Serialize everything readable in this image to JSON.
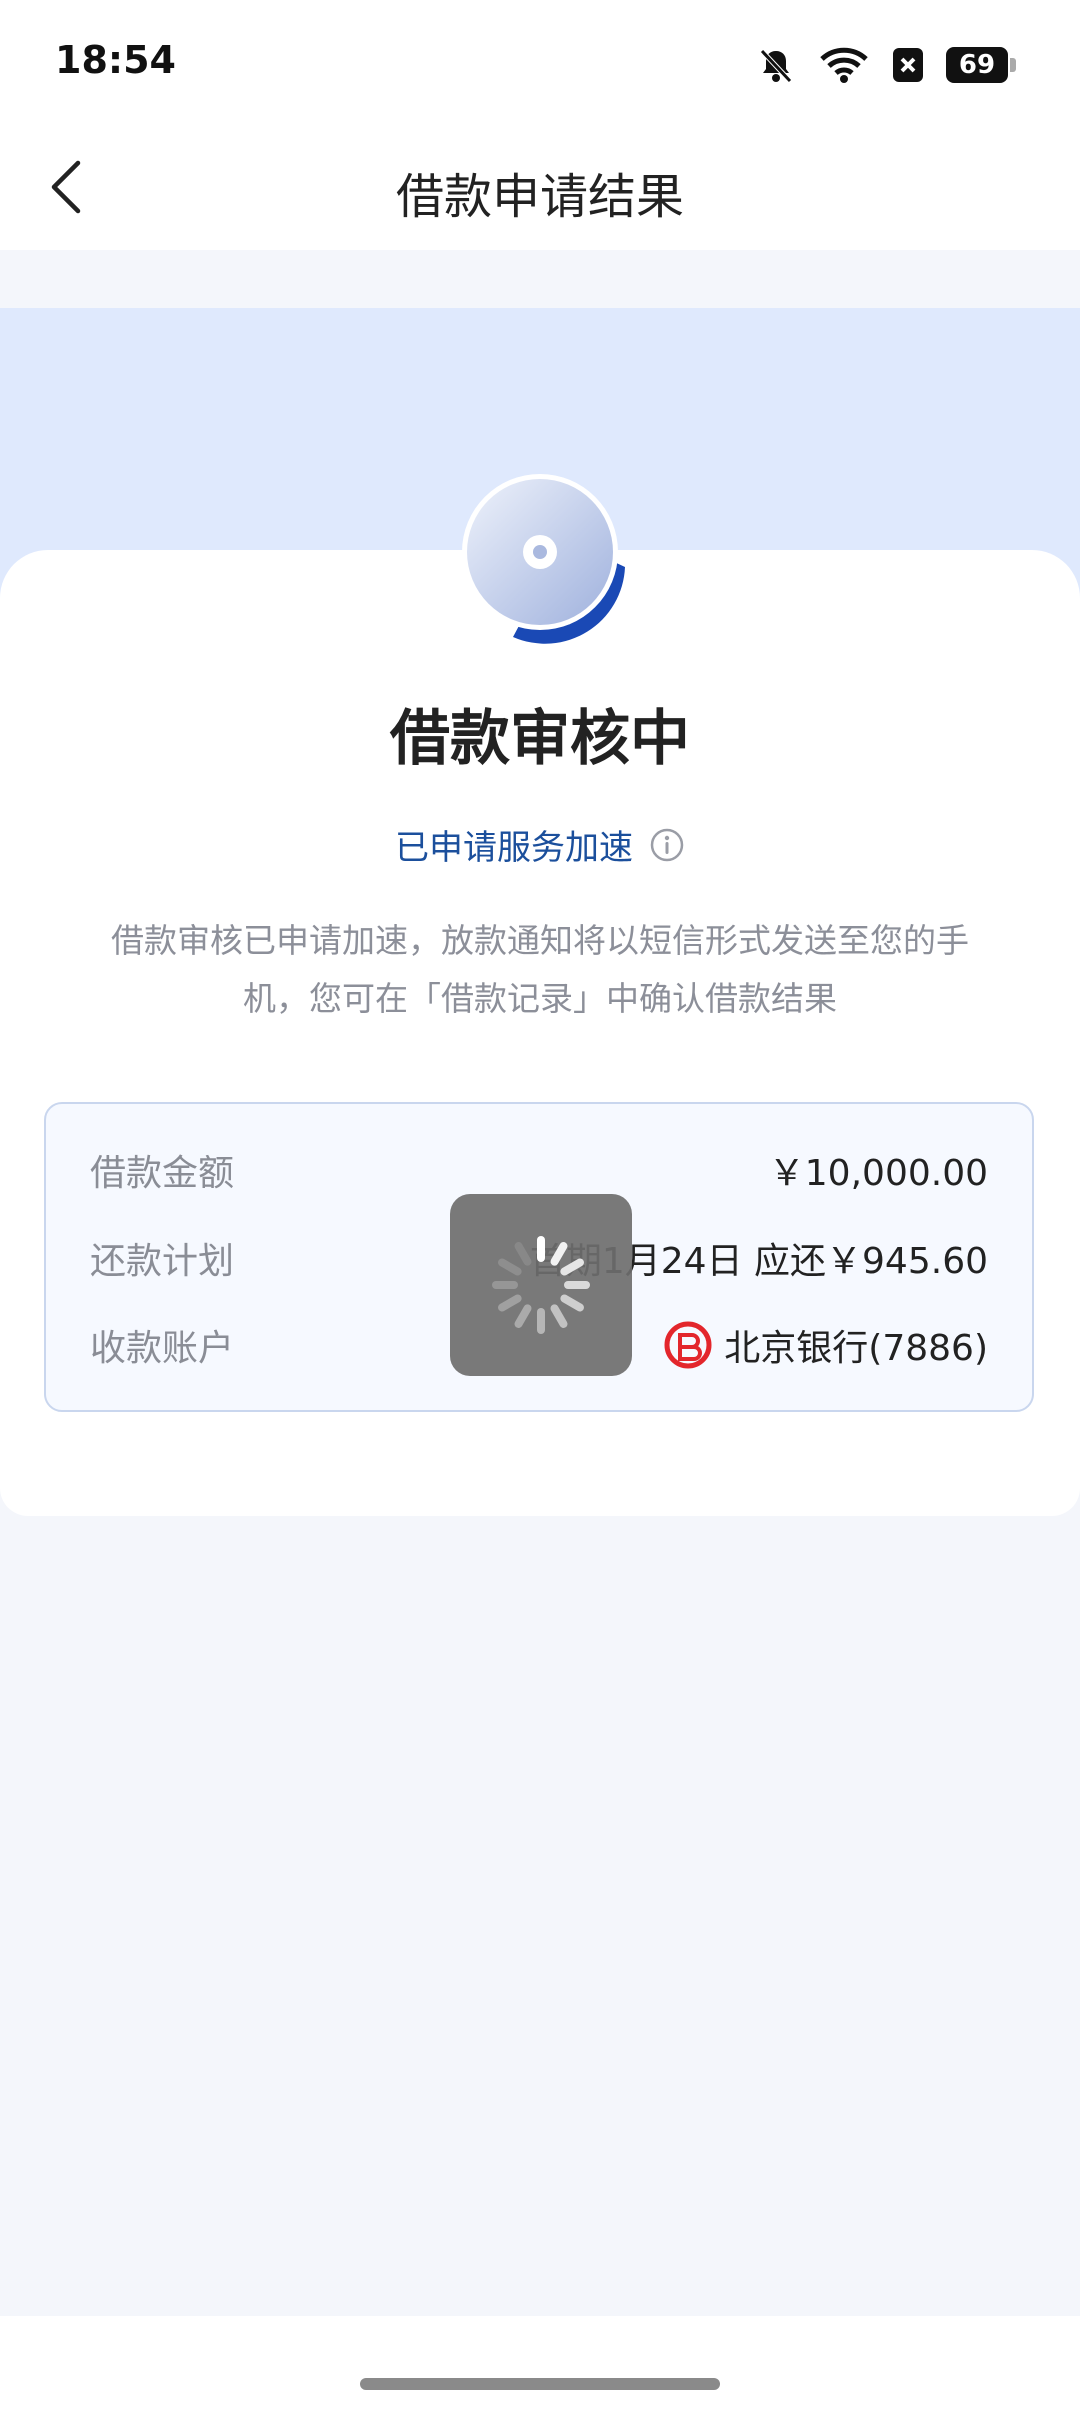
{
  "status_bar": {
    "time": "18:54",
    "battery": "69",
    "icons": [
      "bell-off-icon",
      "wifi-icon",
      "close-box-icon",
      "battery-icon"
    ]
  },
  "nav": {
    "title": "借款申请结果",
    "back_icon": "chevron-left-icon"
  },
  "main": {
    "status_title": "借款审核中",
    "accelerate_link": "已申请服务加速",
    "description": "借款审核已申请加速，放款通知将以短信形式发送至您的手机，您可在「借款记录」中确认借款结果",
    "details": [
      {
        "label": "借款金额",
        "value": "￥10,000.00"
      },
      {
        "label": "还款计划",
        "value": "首期1月24日 应还￥945.60"
      },
      {
        "label": "收款账户",
        "value": "北京银行(7886)"
      }
    ]
  },
  "colors": {
    "accent": "#1b4f9c",
    "banner": "#dfe9fd",
    "background": "#f4f6fb",
    "bank_logo": "#e3262c"
  }
}
